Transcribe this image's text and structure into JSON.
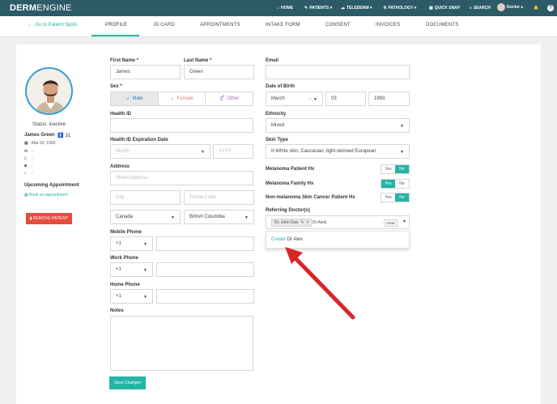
{
  "app": {
    "logo_bold": "DERM",
    "logo_light": "ENGINE"
  },
  "nav": {
    "home": "HOME",
    "patients": "PATIENTS",
    "telederm": "TELEDERM",
    "pathology": "PATHOLOGY",
    "quick_snap": "QUICK SNAP",
    "search": "SEARCH",
    "user": "Doctor"
  },
  "tabs": {
    "back": "Go to Patient Spots",
    "items": [
      "PROFILE",
      "ID CARD",
      "APPOINTMENTS",
      "INTAKE FORM",
      "CONSENT",
      "INVOICES",
      "DOCUMENTS"
    ]
  },
  "patient": {
    "status": "Status: Inactive",
    "name": "James Green",
    "age": "31",
    "dob": "Mar 03, 1993",
    "email": "-",
    "phone": "-",
    "work": "-",
    "home": "-",
    "upcoming_title": "Upcoming Appointment",
    "book_link": "Book an appointment",
    "remove_label": "REMOVE PATIENT"
  },
  "form": {
    "first_name_label": "First Name *",
    "first_name": "James",
    "last_name_label": "Last Name *",
    "last_name": "Green",
    "sex_label": "Sex *",
    "sex_male": "Male",
    "sex_female": "Female",
    "sex_other": "Other",
    "health_id_label": "Health ID",
    "health_id_exp_label": "Health ID Expiration Date",
    "month_placeholder": "Month",
    "year_placeholder": "YYYY",
    "address_label": "Address",
    "street_placeholder": "Street Address",
    "city_placeholder": "City",
    "postal_placeholder": "Postal Code",
    "country": "Canada",
    "province": "British Columbia",
    "mobile_label": "Mobile Phone",
    "work_label": "Work Phone",
    "home_label": "Home Phone",
    "phone_code": "+1",
    "notes_label": "Notes",
    "save_label": "Save Changes",
    "email_label": "Email",
    "dob_label": "Date of Birth",
    "dob_month": "March",
    "dob_day": "03",
    "dob_year": "1993",
    "ethnicity_label": "Ethnicity",
    "ethnicity": "Mixed",
    "skin_type_label": "Skin Type",
    "skin_type": "II-White skin, Caucasian, light-skinned European",
    "melanoma_hx_label": "Melanoma Patient Hx",
    "melanoma_family_label": "Melanoma Family Hx",
    "non_melanoma_label": "Non-melanoma Skin Cancer Patient Hx",
    "yes": "Yes",
    "no": "No",
    "ref_label": "Referring Doctor(s)",
    "ref_chip": "Dr. John Doe",
    "ref_typed": "Dr Alex|",
    "clear": "Clear",
    "create_word": "Create",
    "create_name": " Dr Alex"
  },
  "colors": {
    "navbar": "#2d5a67",
    "accent": "#23b5a6",
    "danger": "#e74c3c",
    "arrow": "#d9262a"
  }
}
